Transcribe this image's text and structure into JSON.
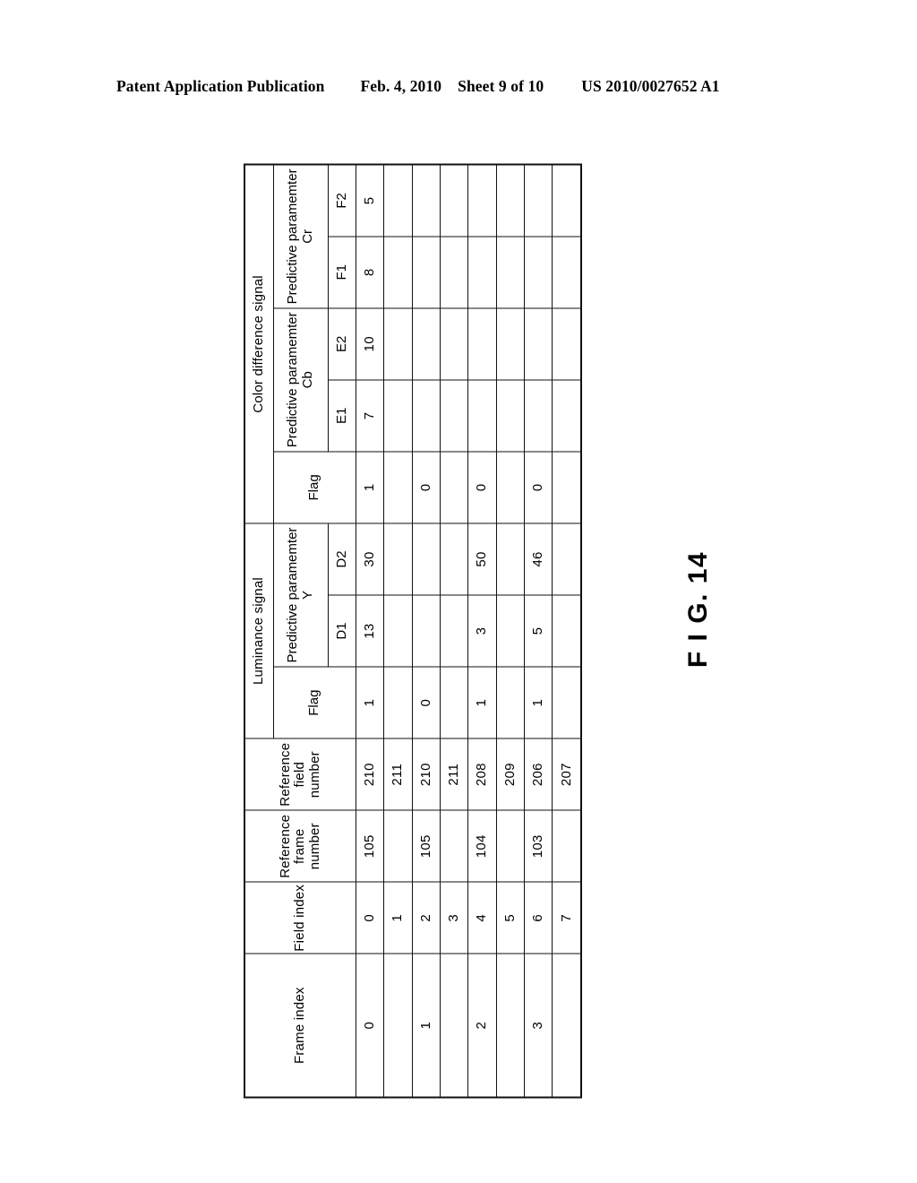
{
  "page_header": {
    "publication": "Patent Application Publication",
    "date": "Feb. 4, 2010",
    "sheet": "Sheet 9 of 10",
    "patent_number": "US 2010/0027652 A1"
  },
  "figure": {
    "caption": "F I G. 14",
    "rotation_degrees": -90
  },
  "table": {
    "headers": {
      "frame_index": "Frame index",
      "field_index": "Field index",
      "reference_frame_number": "Reference frame number",
      "reference_field_number": "Reference field number",
      "luminance_signal": "Luminance signal",
      "luminance_flag": "Flag",
      "luminance_predictive_parameter": "Predictive paramemter Y",
      "luminance_d1": "D1",
      "luminance_d2": "D2",
      "color_difference_signal": "Color difference signal",
      "color_flag": "Flag",
      "color_predictive_parameter_cb": "Predictive paramemter Cb",
      "color_e1": "E1",
      "color_e2": "E2",
      "color_predictive_parameter_cr": "Predictive paramemter Cr",
      "color_f1": "F1",
      "color_f2": "F2"
    },
    "rows": [
      {
        "frame_index": "0",
        "field_index": [
          "0",
          "1"
        ],
        "reference_frame_number": "105",
        "reference_field_number": [
          "210",
          "211"
        ],
        "luminance_flag": "1",
        "luminance_d1": "13",
        "luminance_d2": "30",
        "color_flag": "1",
        "color_e1": "7",
        "color_e2": "10",
        "color_f1": "8",
        "color_f2": "5"
      },
      {
        "frame_index": "1",
        "field_index": [
          "2",
          "3"
        ],
        "reference_frame_number": "105",
        "reference_field_number": [
          "210",
          "211"
        ],
        "luminance_flag": "0",
        "luminance_d1": "",
        "luminance_d2": "",
        "color_flag": "0",
        "color_e1": "",
        "color_e2": "",
        "color_f1": "",
        "color_f2": ""
      },
      {
        "frame_index": "2",
        "field_index": [
          "4",
          "5"
        ],
        "reference_frame_number": "104",
        "reference_field_number": [
          "208",
          "209"
        ],
        "luminance_flag": "1",
        "luminance_d1": "3",
        "luminance_d2": "50",
        "color_flag": "0",
        "color_e1": "",
        "color_e2": "",
        "color_f1": "",
        "color_f2": ""
      },
      {
        "frame_index": "3",
        "field_index": [
          "6",
          "7"
        ],
        "reference_frame_number": "103",
        "reference_field_number": [
          "206",
          "207"
        ],
        "luminance_flag": "1",
        "luminance_d1": "5",
        "luminance_d2": "46",
        "color_flag": "0",
        "color_e1": "",
        "color_e2": "",
        "color_f1": "",
        "color_f2": ""
      }
    ]
  }
}
